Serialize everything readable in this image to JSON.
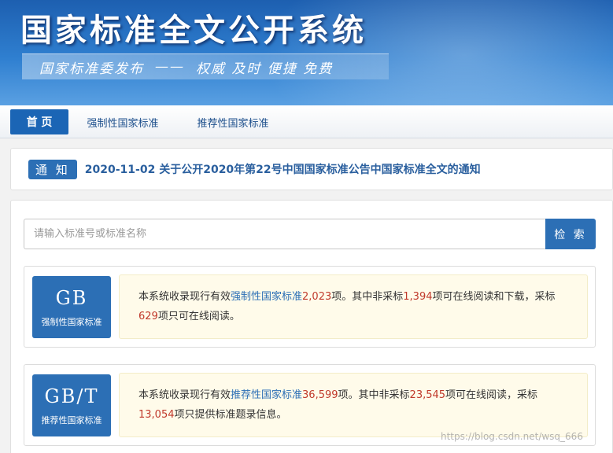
{
  "banner": {
    "title": "国家标准全文公开系统",
    "publisher": "国家标准委发布",
    "dash": "——",
    "slogan": "权威 及时 便捷 免费"
  },
  "nav": {
    "items": [
      {
        "label": "首 页",
        "active": true
      },
      {
        "label": "强制性国家标准",
        "active": false
      },
      {
        "label": "推荐性国家标准",
        "active": false
      }
    ]
  },
  "notice": {
    "badge": "通 知",
    "text": "2020-11-02  关于公开2020年第22号中国国家标准公告中国家标准全文的通知"
  },
  "search": {
    "placeholder": "请输入标准号或标准名称",
    "button": "检 索"
  },
  "cards": [
    {
      "code": "GB",
      "caption": "强制性国家标准",
      "p1": "本系统收录现行有效",
      "type": "强制性国家标准",
      "total": "2,023",
      "p2": "项。其中非采标",
      "n1": "1,394",
      "p3": "项可在线阅读和下载，采标",
      "n2": "629",
      "p4": "项只可在线阅读。"
    },
    {
      "code": "GB/T",
      "caption": "推荐性国家标准",
      "p1": "本系统收录现行有效",
      "type": "推荐性国家标准",
      "total": "36,599",
      "p2": "项。其中非采标",
      "n1": "23,545",
      "p3": "项可在线阅读，采标",
      "n2": "13,054",
      "p4": "项只提供标准题录信息。"
    }
  ],
  "watermark": "https://blog.csdn.net/wsq_666",
  "colors": {
    "primary": "#2c6fb5",
    "highlight_red": "#c0392b",
    "card_bg": "#fffbea"
  }
}
